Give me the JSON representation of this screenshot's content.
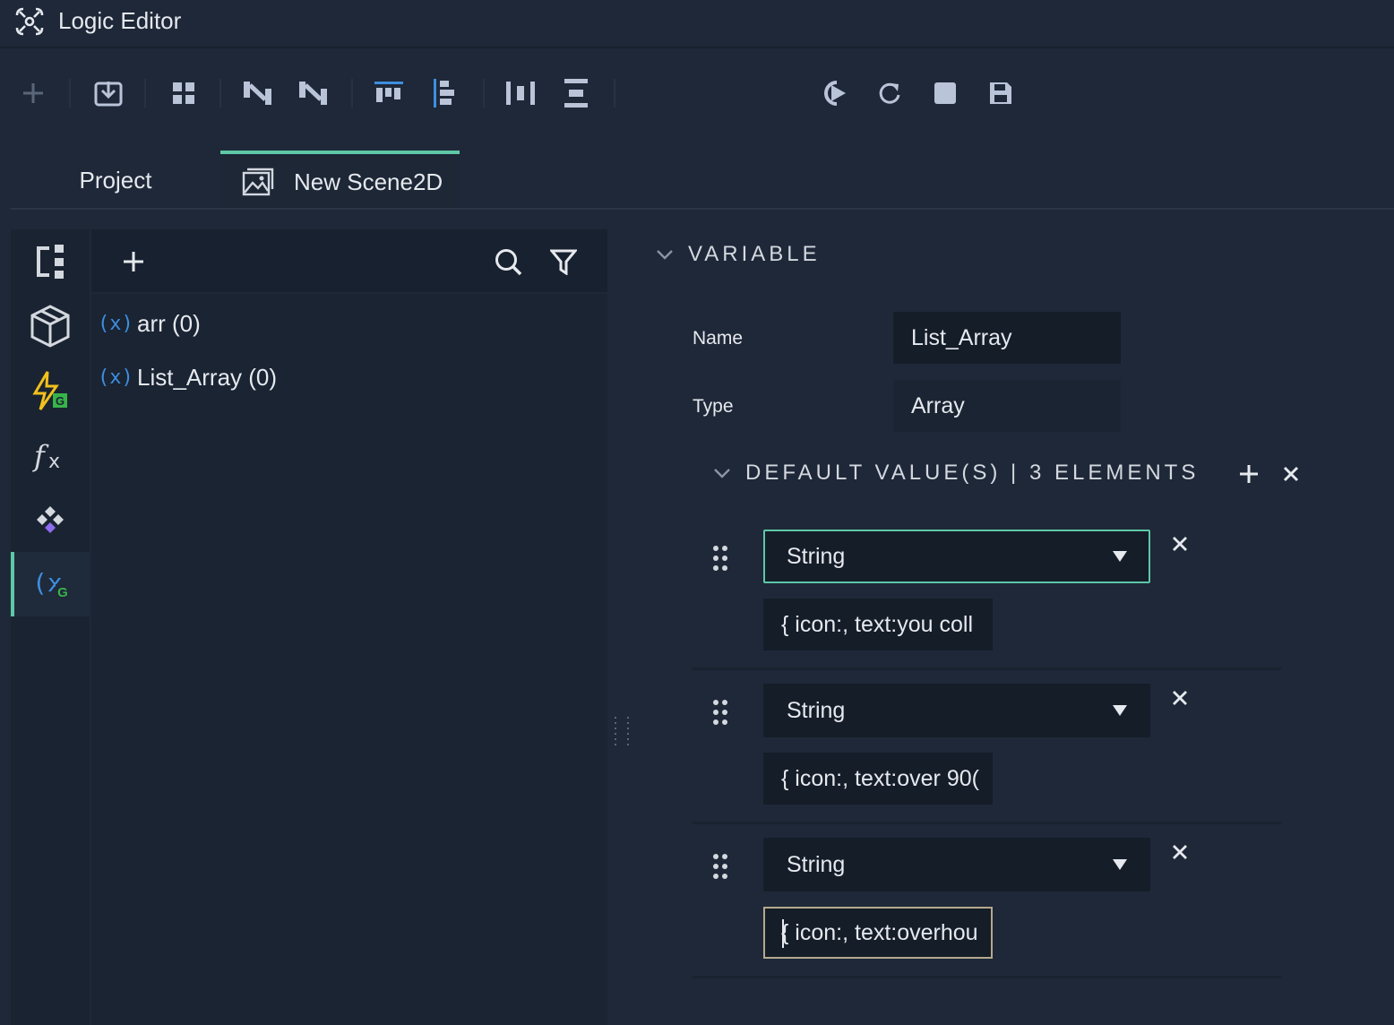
{
  "window": {
    "title": "Logic Editor"
  },
  "toolbar": {
    "left_icons": [
      "add-icon",
      "import-icon",
      "grid-icon",
      "connect-nodes-icon",
      "connect-nodes-alt-icon",
      "align-top-icon",
      "align-left-icon",
      "distribute-horizontal-icon",
      "distribute-vertical-icon"
    ],
    "right_icons": [
      "run-from-start-icon",
      "restart-icon",
      "stop-icon",
      "save-icon"
    ]
  },
  "tabs": [
    {
      "label": "Project",
      "active": false
    },
    {
      "label": "New Scene2D",
      "active": true
    }
  ],
  "rail": {
    "items": [
      "hierarchy-icon",
      "object-cube-icon",
      "global-events-icon",
      "functions-icon",
      "components-icon",
      "global-variables-icon"
    ],
    "active": "global-variables-icon"
  },
  "variables": {
    "items": [
      {
        "icon": "(x)",
        "label": "arr (0)"
      },
      {
        "icon": "(x)",
        "label": "List_Array (0)"
      }
    ]
  },
  "properties": {
    "section_title": "VARIABLE",
    "name_label": "Name",
    "name_value": "List_Array",
    "type_label": "Type",
    "type_value": "Array",
    "defaults_title": "DEFAULT VALUE(S) | 3 ELEMENTS",
    "elements": [
      {
        "type": "String",
        "value": "{ icon:, text:you coll"
      },
      {
        "type": "String",
        "value": "{ icon:, text:over 90("
      },
      {
        "type": "String",
        "value": "{ icon:, text:overhou"
      }
    ]
  },
  "colors": {
    "accent": "#5ec8a6",
    "variable_icon": "#3d8fe0",
    "event_yellow": "#f2c01c",
    "event_green": "#37b34a",
    "components_purple": "#8e6cf0"
  }
}
